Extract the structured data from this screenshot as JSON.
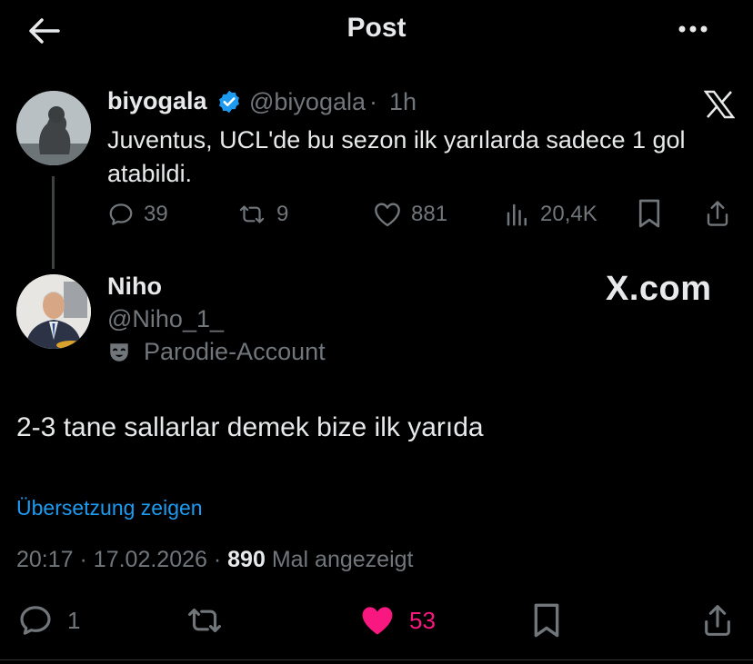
{
  "header": {
    "title": "Post",
    "back_icon": "arrow-left-icon",
    "more_icon": "more-horizontal-icon"
  },
  "quoted": {
    "name": "biyogala",
    "handle": "@biyogala",
    "separator": "·",
    "time": "1h",
    "text": "Juventus, UCL'de bu sezon ilk yarılarda sadece 1 gol atabildi.",
    "replies": "39",
    "reposts": "9",
    "likes": "881",
    "views": "20,4K",
    "verified_color": "#1d9bf0"
  },
  "post": {
    "name": "Niho",
    "handle": "@Niho_1_",
    "parody_label": "Parodie-Account",
    "watermark": "X.com",
    "text": "2-3 tane sallarlar demek bize ilk yarıda",
    "translate": "Übersetzung zeigen",
    "time": "20:17",
    "date": "17.02.2026",
    "views_count": "890",
    "views_label": "Mal angezeigt",
    "dot": "·",
    "replies": "1",
    "likes": "53",
    "like_color": "#f91880"
  }
}
